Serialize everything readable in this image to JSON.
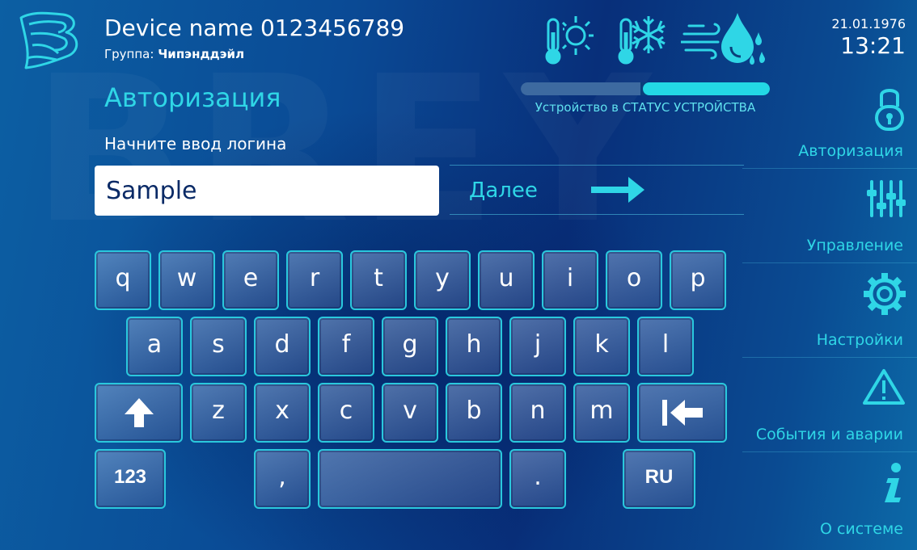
{
  "watermark": "BREY",
  "header": {
    "device_name": "Device name 0123456789",
    "group_label": "Группа:",
    "group_value": "Чипэнддэйл",
    "date": "21.01.1976",
    "time": "13:21"
  },
  "mode_icons": [
    "thermometer-sun-icon",
    "thermometer-snowflake-icon",
    "wind-drops-icon"
  ],
  "status": {
    "text": "Устройство в СТАТУС УСТРОЙСТВА",
    "progress_fraction": 0.5
  },
  "page": {
    "title": "Авторизация",
    "prompt": "Начните ввод логина"
  },
  "login_input": {
    "value": "Sample"
  },
  "next_button": {
    "label": "Далее"
  },
  "keyboard": {
    "row1": [
      "q",
      "w",
      "e",
      "r",
      "t",
      "y",
      "u",
      "i",
      "o",
      "p"
    ],
    "row2": [
      "a",
      "s",
      "d",
      "f",
      "g",
      "h",
      "j",
      "k",
      "l"
    ],
    "row3": [
      "z",
      "x",
      "c",
      "v",
      "b",
      "n",
      "m"
    ],
    "numbers_key": "123",
    "comma_key": ",",
    "period_key": ".",
    "language_key": "RU"
  },
  "sidebar": {
    "items": [
      {
        "label": "Авторизация",
        "icon": "lock-icon"
      },
      {
        "label": "Управление",
        "icon": "sliders-icon"
      },
      {
        "label": "Настройки",
        "icon": "gear-icon"
      },
      {
        "label": "События и аварии",
        "icon": "warning-icon"
      },
      {
        "label": "О системе",
        "icon": "info-icon"
      }
    ]
  },
  "colors": {
    "accent": "#2fd6e6",
    "background_dark": "#082f7a",
    "background_light": "#0c6aa8",
    "key_border": "#2ac8dd"
  }
}
